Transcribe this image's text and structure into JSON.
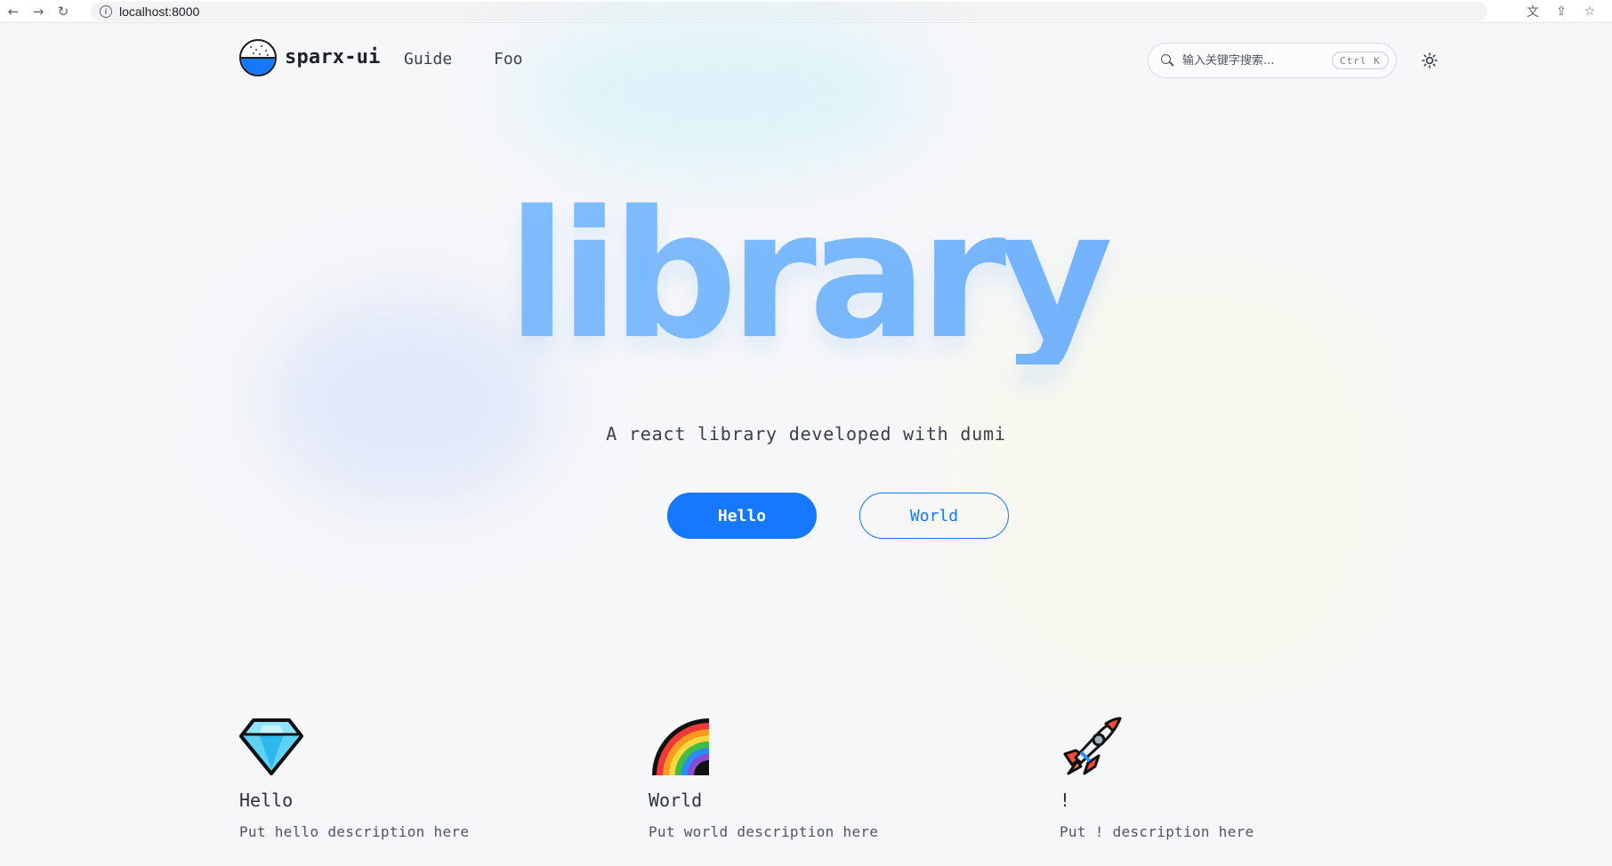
{
  "browser": {
    "url": "localhost:8000",
    "info_glyph": "i",
    "back_glyph": "←",
    "forward_glyph": "→",
    "reload_glyph": "↻",
    "translate_glyph": "文",
    "share_glyph": "⇪",
    "star_glyph": "☆"
  },
  "header": {
    "brand": "sparx-ui",
    "nav": [
      "Guide",
      "Foo"
    ],
    "search_placeholder": "输入关键字搜索...",
    "search_shortcut": "Ctrl K"
  },
  "hero": {
    "title": "library",
    "description": "A react library developed with dumi",
    "primary_action": "Hello",
    "secondary_action": "World"
  },
  "features": [
    {
      "icon": "gem-icon",
      "title": "Hello",
      "description": "Put hello description here"
    },
    {
      "icon": "rainbow-icon",
      "title": "World",
      "description": "Put world description here"
    },
    {
      "icon": "rocket-icon",
      "title": "!",
      "description": "Put ! description here"
    }
  ],
  "colors": {
    "accent": "#1677ff",
    "hero_gradient_start": "#8cc6ff",
    "hero_gradient_end": "#6aa7fa",
    "background": "#f6f7f9"
  }
}
